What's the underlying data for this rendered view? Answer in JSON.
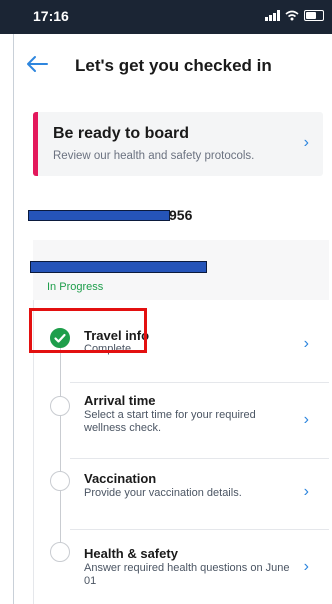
{
  "status_bar": {
    "time": "17:16"
  },
  "header": {
    "title": "Let's get you checked in"
  },
  "board_card": {
    "title": "Be ready to board",
    "subtitle": "Review our health and safety protocols.",
    "accent_color": "#e3185c"
  },
  "booking": {
    "number_suffix": "956"
  },
  "trip": {
    "status": "In Progress",
    "status_color": "#1e9e4b"
  },
  "steps": [
    {
      "title": "Travel info",
      "desc": "Complete",
      "complete": true
    },
    {
      "title": "Arrival time",
      "desc": "Select a start time for your required wellness check.",
      "complete": false
    },
    {
      "title": "Vaccination",
      "desc": "Provide your vaccination details.",
      "complete": false
    },
    {
      "title": "Health & safety",
      "desc": "Answer required health questions on June 01",
      "complete": false
    }
  ],
  "icons": {
    "back": "arrow-left-icon",
    "chevron": "chevron-right-icon",
    "check": "checkmark-icon"
  },
  "colors": {
    "link": "#2e86de",
    "highlight": "#e31010"
  }
}
